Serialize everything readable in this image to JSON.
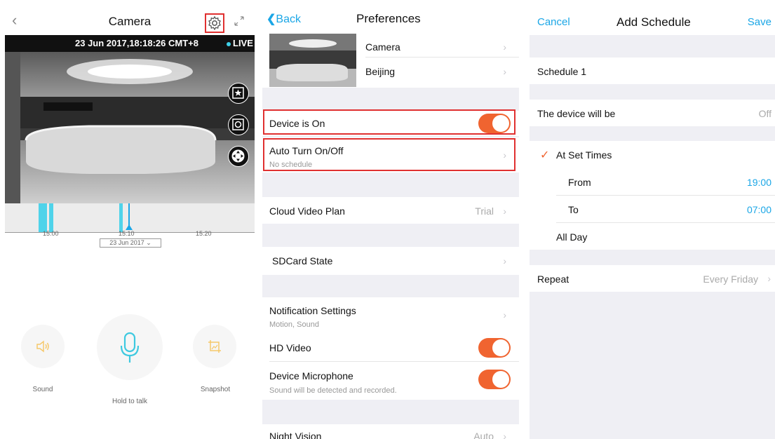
{
  "camera": {
    "title": "Camera",
    "timestamp": "23 Jun 2017,18:18:26 CMT+8",
    "live": "LIVE",
    "timeline_ticks": [
      "15:00",
      "15:10",
      "15:20"
    ],
    "date": "23 Jun 2017",
    "controls": [
      {
        "label": "Sound"
      },
      {
        "label": "Hold to talk"
      },
      {
        "label": "Snapshot"
      }
    ]
  },
  "preferences": {
    "back": "Back",
    "title": "Preferences",
    "camera_name": "Camera",
    "location": "Beijing",
    "device_on": "Device is On",
    "auto_turn": "Auto Turn On/Off",
    "auto_turn_sub": "No schedule",
    "cloud_plan": "Cloud Video Plan",
    "cloud_plan_value": "Trial",
    "sdcard": "SDCard State",
    "notification": "Notification Settings",
    "notification_sub": "Motion, Sound",
    "hd_video": "HD Video",
    "mic": "Device Microphone",
    "mic_sub": "Sound will be detected and recorded.",
    "night_vision": "Night Vision",
    "night_vision_value": "Auto",
    "toggles": {
      "device_on": true,
      "hd_video": true,
      "mic": true
    }
  },
  "schedule": {
    "cancel": "Cancel",
    "title": "Add Schedule",
    "save": "Save",
    "name": "Schedule 1",
    "device_will_be": "The device will be",
    "device_will_be_value": "Off",
    "at_set_times": "At Set Times",
    "from": "From",
    "from_value": "19:00",
    "to": "To",
    "to_value": "07:00",
    "all_day": "All Day",
    "repeat": "Repeat",
    "repeat_value": "Every Friday"
  },
  "colors": {
    "accent": "#1aa6e6",
    "toggle": "#f06430",
    "highlight": "#e03030",
    "live_dot": "#3ed0e8"
  }
}
